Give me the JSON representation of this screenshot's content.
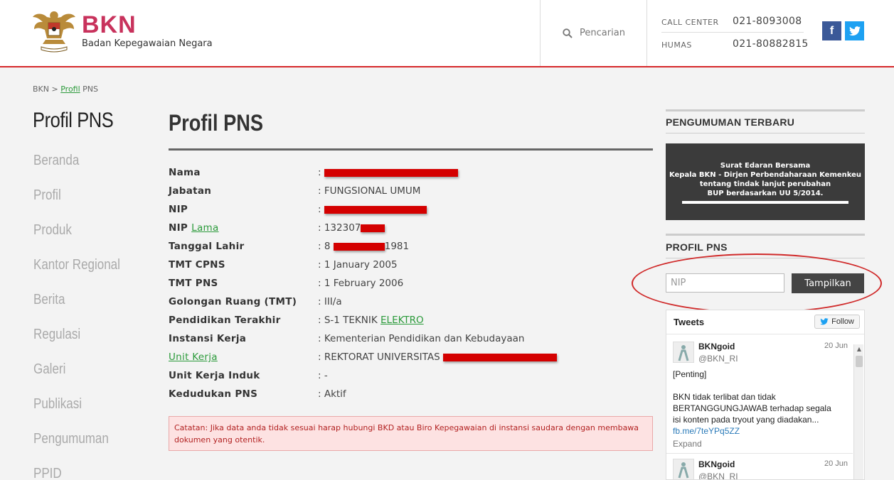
{
  "header": {
    "logo_title": "BKN",
    "logo_subtitle": "Badan Kepegawaian Negara",
    "search_label": "Pencarian",
    "call_center_label": "CALL CENTER",
    "call_center_number": "021-8093008",
    "humas_label": "HUMAS",
    "humas_number": "021-80882815",
    "facebook_glyph": "f",
    "twitter_glyph": "t"
  },
  "breadcrumb": {
    "root": "BKN",
    "sep": " > ",
    "link": "Profil",
    "current": " PNS"
  },
  "nav": {
    "title": "Profil PNS",
    "items": [
      "Beranda",
      "Profil",
      "Produk",
      "Kantor Regional",
      "Berita",
      "Regulasi",
      "Galeri",
      "Publikasi",
      "Pengumuman",
      "PPID"
    ]
  },
  "main": {
    "title": "Profil PNS",
    "rows": [
      {
        "label": "Nama",
        "value": ":"
      },
      {
        "label": "Jabatan",
        "value": ": FUNGSIONAL UMUM"
      },
      {
        "label": "NIP",
        "value": ":"
      },
      {
        "label": "NIP",
        "label_link": "Lama",
        "value": ": 132307"
      },
      {
        "label": "Tanggal Lahir",
        "value": ": 8",
        "value_suffix": "1981"
      },
      {
        "label": "TMT CPNS",
        "value": ": 1 January 2005"
      },
      {
        "label": "TMT PNS",
        "value": ": 1 February 2006"
      },
      {
        "label": "Golongan Ruang (TMT)",
        "value": ": III/a"
      },
      {
        "label": "Pendidikan Terakhir",
        "value": ": S-1 TEKNIK ",
        "value_link": "ELEKTRO"
      },
      {
        "label": "Instansi Kerja",
        "value": ": Kementerian Pendidikan dan Kebudayaan"
      },
      {
        "label": "Unit Kerja",
        "value": ": REKTORAT UNIVERSITAS"
      },
      {
        "label": "Unit Kerja Induk",
        "value": ": -"
      },
      {
        "label": "Kedudukan PNS",
        "value": ": Aktif"
      }
    ],
    "note": "Catatan: Jika data anda tidak sesuai harap hubungi BKD atau Biro Kepegawaian di instansi saudara dengan membawa dokumen yang otentik."
  },
  "sidebar": {
    "announcement_title": "PENGUMUMAN TERBARU",
    "banner_lines": [
      "Surat Edaran Bersama",
      "Kepala BKN - Dirjen Perbendaharaan Kemenkeu",
      "tentang tindak lanjut perubahan",
      "BUP berdasarkan UU 5/2014."
    ],
    "profile_title": "PROFIL PNS",
    "nip_placeholder": "NIP",
    "show_button": "Tampilkan"
  },
  "tweets": {
    "title": "Tweets",
    "follow": "Follow",
    "items": [
      {
        "name": "BKNgoid",
        "handle": "@BKN_RI",
        "date": "20 Jun",
        "lines": [
          "[Penting]",
          "",
          "BKN tidak terlibat dan tidak",
          "BERTANGGUNGJAWAB terhadap segala",
          "isi konten pada tryout yang diadakan..."
        ],
        "link": "fb.me/7teYPq5ZZ",
        "expand": "Expand"
      },
      {
        "name": "BKNgoid",
        "handle": "@BKN_RI",
        "date": "20 Jun"
      }
    ]
  },
  "colors": {
    "accent": "#d6282a",
    "brand": "#c8325c",
    "link": "#2b9a3a",
    "redaction": "#d40000"
  }
}
